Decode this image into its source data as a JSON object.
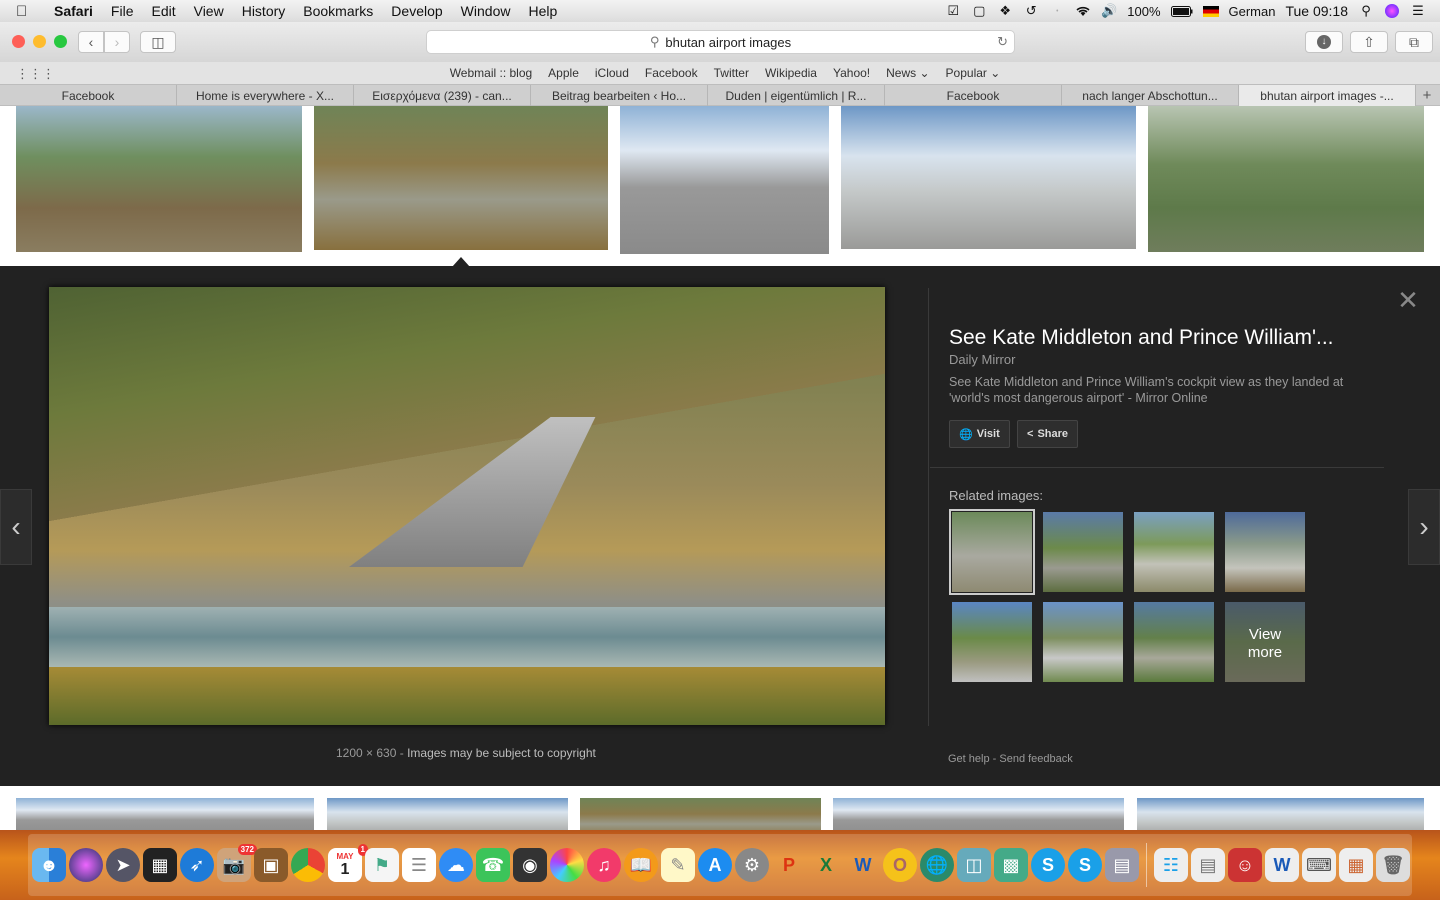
{
  "menubar": {
    "app": "Safari",
    "items": [
      "File",
      "Edit",
      "View",
      "History",
      "Bookmarks",
      "Develop",
      "Window",
      "Help"
    ],
    "battery": "100%",
    "input_source": "German",
    "clock": "Tue 09:18"
  },
  "toolbar": {
    "url": "bhutan airport images"
  },
  "favorites": [
    "Webmail :: blog",
    "Apple",
    "iCloud",
    "Facebook",
    "Twitter",
    "Wikipedia",
    "Yahoo!",
    "News ⌄",
    "Popular ⌄"
  ],
  "tabs": [
    {
      "label": "Facebook",
      "active": false
    },
    {
      "label": "Home is everywhere - X...",
      "active": false
    },
    {
      "label": "Εισερχόμενα (239) - can...",
      "active": false
    },
    {
      "label": "Beitrag bearbeiten ‹ Ho...",
      "active": false
    },
    {
      "label": "Duden | eigentümlich | R...",
      "active": false
    },
    {
      "label": "Facebook",
      "active": false
    },
    {
      "label": "nach langer Abschottun...",
      "active": false
    },
    {
      "label": "bhutan airport images -...",
      "active": true
    }
  ],
  "viewer": {
    "caption_size": "1200 × 630",
    "caption_sep": " - ",
    "caption_copyright": "Images may be subject to copyright",
    "title": "See Kate Middleton and Prince William'...",
    "source": "Daily Mirror",
    "description": "See Kate Middleton and Prince William's cockpit view as they landed at 'world's most dangerous airport' - Mirror Online",
    "visit_label": "Visit",
    "share_label": "Share",
    "related_label": "Related images:",
    "view_more_line1": "View",
    "view_more_line2": "more",
    "get_help": "Get help",
    "footer_sep": " - ",
    "send_feedback": "Send feedback"
  },
  "dock": {
    "calendar_month": "MAY",
    "calendar_day": "1",
    "photos_badge": "372",
    "calendar_badge": "1"
  }
}
